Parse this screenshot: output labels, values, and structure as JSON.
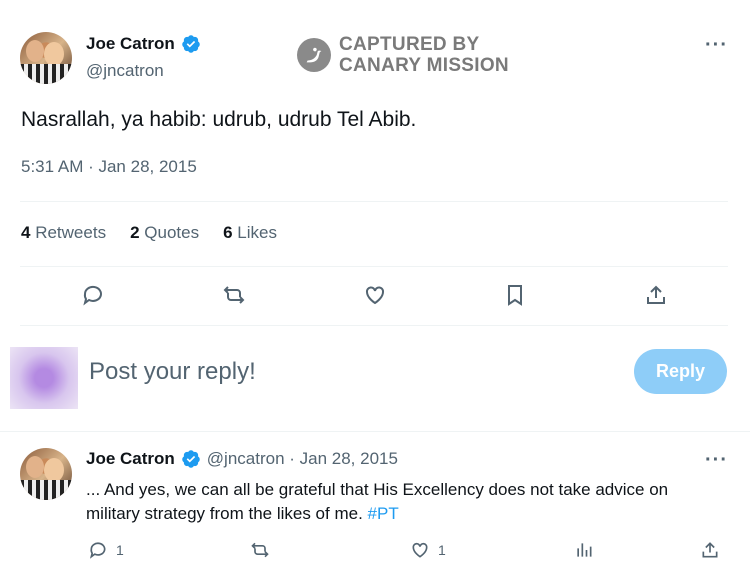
{
  "tweet": {
    "author_name": "Joe Catron",
    "handle": "@jncatron",
    "text": "Nasrallah, ya habib: udrub, udrub Tel Abib.",
    "timestamp": "5:31 AM · Jan 28, 2015",
    "stats": {
      "retweets_count": "4",
      "retweets_label": "Retweets",
      "quotes_count": "2",
      "quotes_label": "Quotes",
      "likes_count": "6",
      "likes_label": "Likes"
    },
    "more_label": "···"
  },
  "watermark": {
    "line1": "CAPTURED BY",
    "line2": "CANARY MISSION"
  },
  "reply_composer": {
    "placeholder": "Post your reply!",
    "button_label": "Reply"
  },
  "reply_tweet": {
    "author_name": "Joe Catron",
    "handle_date": "@jncatron · Jan 28, 2015",
    "text": "... And yes, we can all be grateful that His Excellency does not take advice on military strategy from the likes of me.",
    "hashtag": "#PT",
    "reply_count": "1",
    "like_count": "1",
    "more_label": "···"
  },
  "colors": {
    "accent": "#1d9bf0",
    "reply_button": "#8ecdf8",
    "secondary_text": "#536471"
  }
}
